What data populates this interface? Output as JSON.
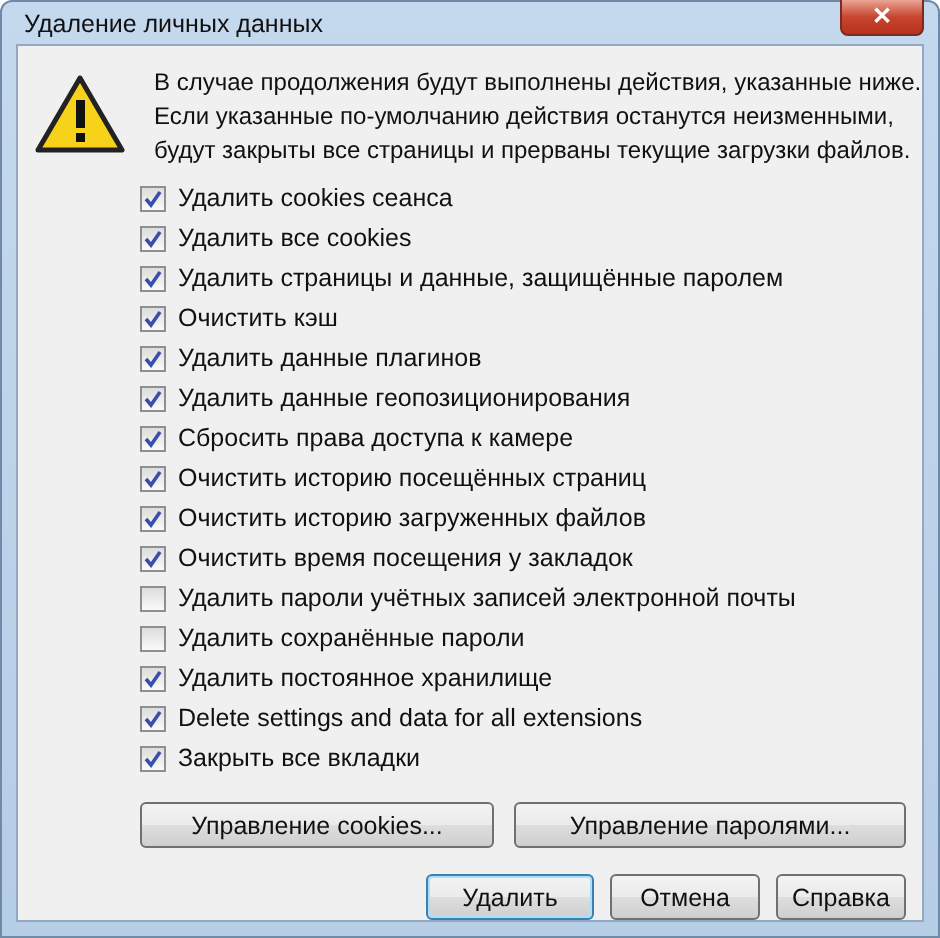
{
  "window": {
    "title": "Удаление личных данных",
    "close": "✕"
  },
  "message": [
    "В случае продолжения будут выполнены действия, указанные ниже.",
    "Если указанные по-умолчанию действия останутся неизменными,",
    "будут закрыты все страницы и прерваны текущие загрузки файлов."
  ],
  "options": [
    {
      "label": "Удалить cookies сеанса",
      "checked": true
    },
    {
      "label": "Удалить все cookies",
      "checked": true
    },
    {
      "label": "Удалить страницы и данные, защищённые паролем",
      "checked": true
    },
    {
      "label": "Очистить кэш",
      "checked": true
    },
    {
      "label": "Удалить данные плагинов",
      "checked": true
    },
    {
      "label": "Удалить данные геопозиционирования",
      "checked": true
    },
    {
      "label": "Сбросить права доступа к камере",
      "checked": true
    },
    {
      "label": "Очистить историю посещённых страниц",
      "checked": true
    },
    {
      "label": "Очистить историю загруженных файлов",
      "checked": true
    },
    {
      "label": "Очистить время посещения у закладок",
      "checked": true
    },
    {
      "label": "Удалить пароли учётных записей электронной почты",
      "checked": false
    },
    {
      "label": "Удалить сохранённые пароли",
      "checked": false
    },
    {
      "label": "Удалить постоянное хранилище",
      "checked": true
    },
    {
      "label": "Delete settings and data for all extensions",
      "checked": true
    },
    {
      "label": "Закрыть все вкладки",
      "checked": true
    }
  ],
  "manage_buttons": [
    "Управление cookies...",
    "Управление паролями..."
  ],
  "buttons": [
    {
      "label": "Удалить",
      "default": true
    },
    {
      "label": "Отмена",
      "default": false
    },
    {
      "label": "Справка",
      "default": false
    }
  ]
}
